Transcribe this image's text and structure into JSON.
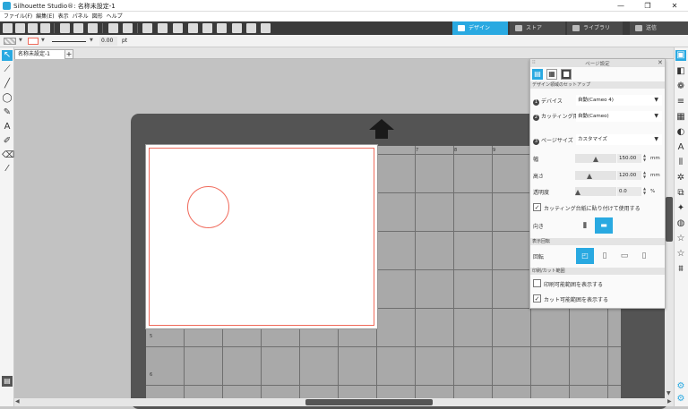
{
  "window": {
    "title": "Silhouette Studio®: 名称未設定-1",
    "minimize": "—",
    "maximize": "❐",
    "close": "✕"
  },
  "menu": [
    "ファイル(F)",
    "編集(E)",
    "表示",
    "パネル",
    "図形",
    "ヘルプ"
  ],
  "nav_tabs": [
    {
      "label": "デザイン",
      "active": true
    },
    {
      "label": "ストア",
      "active": false
    },
    {
      "label": "ライブラリ",
      "active": false
    },
    {
      "label": "送信",
      "active": false
    }
  ],
  "propbar": {
    "line_width": "0.00",
    "unit": "pt"
  },
  "doc_tab": {
    "label": "名称未設定-1",
    "add": "+"
  },
  "ruler": [
    "7",
    "8",
    "9",
    "5",
    "6"
  ],
  "panel": {
    "title": "ページ設定",
    "close": "✕",
    "section_setup": "デザイン領域のセットアップ",
    "device_label": "デバイス",
    "device_value": "自動(Cameo 4)",
    "mat_label": "カッティング用台紙",
    "mat_value": "自動(Cameo)",
    "page_size_label": "ページサイズ",
    "page_size_value": "カスタマイズ",
    "width_label": "幅",
    "width_value": "150.00",
    "width_fraction": 0.5,
    "height_label": "高さ",
    "height_value": "120.00",
    "height_fraction": 0.33,
    "unit_mm": "mm",
    "opacity_label": "透明度",
    "opacity_value": "0.0",
    "opacity_fraction": 0.0,
    "unit_pct": "%",
    "stick_to_mat_label": "カッティング台紙に貼り付けて使用する",
    "stick_to_mat_checked": true,
    "orientation_label": "向き",
    "section_view": "表示回転",
    "rotate_label": "回転",
    "section_print_cut": "印刷/カット範囲",
    "show_print_area_label": "印刷可能範囲を表示する",
    "show_print_area_checked": false,
    "show_cut_area_label": "カット可能範囲を表示する",
    "show_cut_area_checked": true,
    "step_numbers": [
      "1",
      "2",
      "3"
    ]
  },
  "colors": {
    "accent": "#29a9e1",
    "cut_line": "#f06a5b",
    "toolbar": "#3a3a3a",
    "mat": "#545454"
  }
}
